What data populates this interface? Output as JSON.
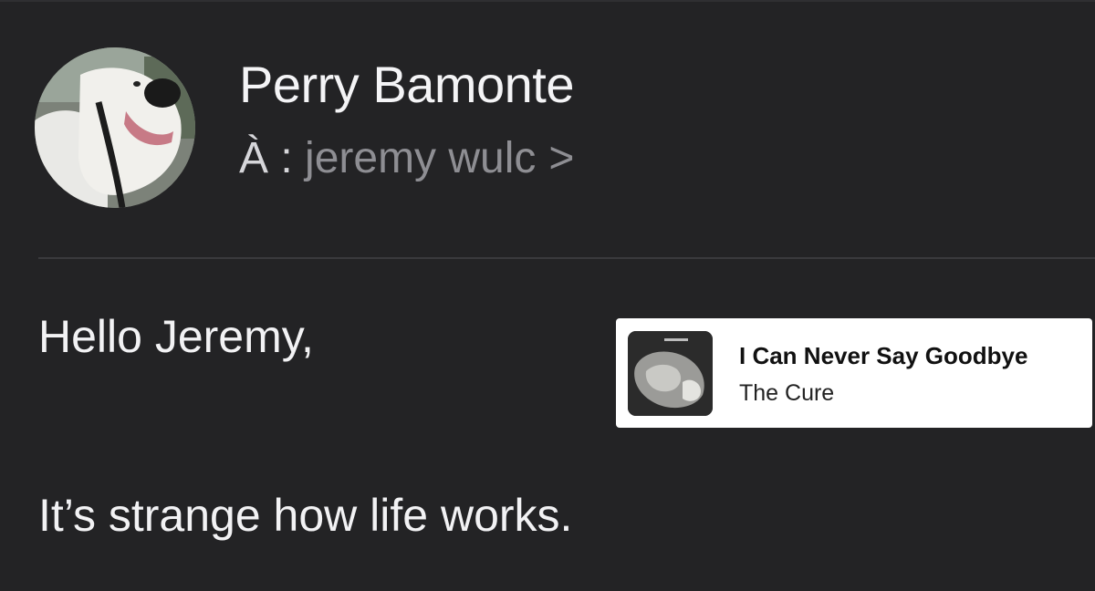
{
  "email": {
    "sender_name": "Perry Bamonte",
    "recipient_prefix": "À :",
    "recipient_name": "jeremy wulc",
    "recipient_chevron": ">",
    "avatar_icon": "dog-photo-avatar",
    "body": {
      "greeting": "Hello Jeremy,",
      "line_1": "It’s strange how life works."
    }
  },
  "music_card": {
    "title": "I Can Never Say Goodbye",
    "artist": "The Cure",
    "artwork_icon": "album-cover-rock"
  },
  "colors": {
    "background": "#232325",
    "secondary_text": "#8e8e93",
    "card_background": "#ffffff"
  }
}
